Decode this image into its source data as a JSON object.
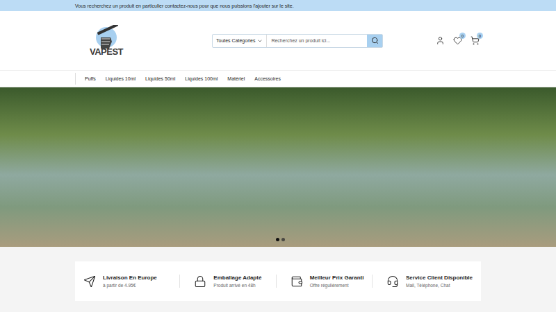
{
  "top_bar": {
    "text": "Vous recherchez un produit en particulier contactez-nous pour que nous puissions l'ajouter sur le site."
  },
  "logo": {
    "text": "VAPEST"
  },
  "search": {
    "category": "Toutes Catégories",
    "placeholder": "Recherchez un produit ici..."
  },
  "header_icons": {
    "wishlist_count": "0",
    "cart_count": "0"
  },
  "nav": {
    "items": [
      "Puffs",
      "Liquides 10ml",
      "Liquides 50ml",
      "Liquides 100ml",
      "Matériel",
      "Accessoires"
    ]
  },
  "hero": {
    "slides": [
      {
        "selected": true
      },
      {
        "selected": false
      }
    ]
  },
  "features": [
    {
      "kind": "send",
      "title": "Livraison En Europe",
      "subtitle": "à partir de 4.95€"
    },
    {
      "kind": "lock",
      "title": "Emballage Adapté",
      "subtitle": "Produit arrivé en 48h"
    },
    {
      "kind": "wallet",
      "title": "Meilleur Prix Garanti",
      "subtitle": "Offre régulièrement"
    },
    {
      "kind": "headset",
      "title": "Service Client Disponible",
      "subtitle": "Mail, Téléphone, Chat"
    }
  ]
}
